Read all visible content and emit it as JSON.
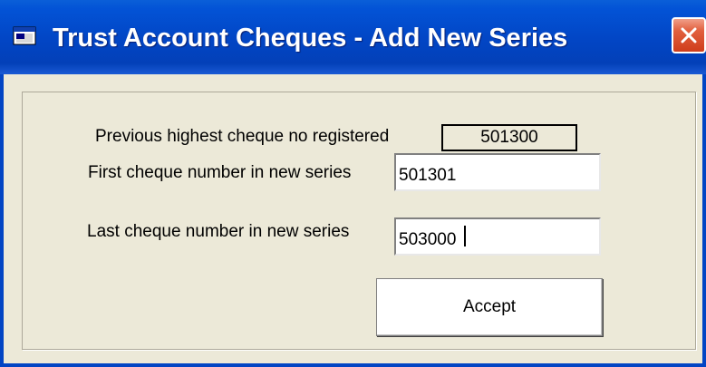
{
  "window": {
    "title": "Trust Account Cheques - Add New Series",
    "icon": "window-app-icon",
    "close_icon": "close-icon"
  },
  "form": {
    "previous_label": "Previous highest cheque no registered",
    "previous_value": "501300",
    "first_label": "First cheque number in new series",
    "first_value": "501301",
    "last_label": "Last cheque number in new series",
    "last_value": "503000",
    "accept_label": "Accept"
  },
  "colors": {
    "titlebar": "#0245c4",
    "face": "#ece9d8",
    "close": "#cf3d1b"
  }
}
